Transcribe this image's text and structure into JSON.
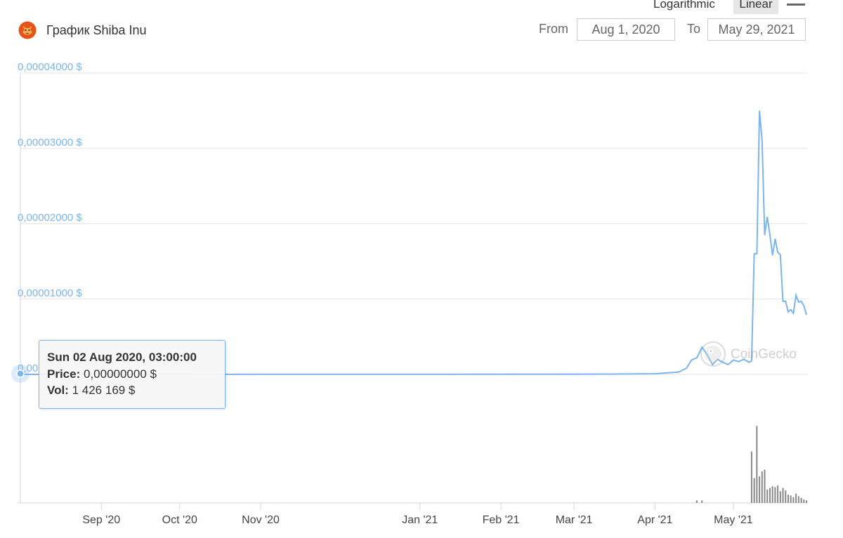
{
  "header": {
    "title": "График Shiba Inu",
    "scale_options": [
      "Logarithmic",
      "Linear"
    ],
    "selected_scale": "Linear",
    "from_label": "From",
    "from_value": "Aug 1, 2020",
    "to_label": "To",
    "to_value": "May 29, 2021"
  },
  "watermark": "CoinGecko",
  "tooltip": {
    "date": "Sun 02 Aug 2020, 03:00:00",
    "price_label": "Price:",
    "price_value": "0,00000000 $",
    "vol_label": "Vol:",
    "vol_value": "1 426 169 $"
  },
  "colors": {
    "price_line": "#7cb5ec",
    "volume_bars": "#888888",
    "tooltip_border": "#7cb5ec"
  },
  "chart_data": {
    "type": "line",
    "x_start": "2020-08-01",
    "x_end": "2021-05-29",
    "ylim": [
      0,
      4e-05
    ],
    "y_ticks": [
      "0,00004000 $",
      "0,00003000 $",
      "0,00002000 $",
      "0,00001000 $",
      "0,00"
    ],
    "x_ticks": [
      "Sep '20",
      "Oct '20",
      "Nov '20",
      "Jan '21",
      "Feb '21",
      "Mar '21",
      "Apr '21",
      "May '21"
    ],
    "x_tick_dates": [
      "2020-09-01",
      "2020-10-01",
      "2020-11-01",
      "2021-01-01",
      "2021-02-01",
      "2021-03-01",
      "2021-04-01",
      "2021-05-01"
    ],
    "price_series": {
      "dates": [
        "2020-08-01",
        "2020-12-01",
        "2021-02-20",
        "2021-03-15",
        "2021-04-01",
        "2021-04-10",
        "2021-04-13",
        "2021-04-15",
        "2021-04-17",
        "2021-04-19",
        "2021-04-21",
        "2021-04-23",
        "2021-04-25",
        "2021-04-27",
        "2021-04-29",
        "2021-05-01",
        "2021-05-03",
        "2021-05-05",
        "2021-05-07",
        "2021-05-08",
        "2021-05-09",
        "2021-05-10",
        "2021-05-11",
        "2021-05-12",
        "2021-05-13",
        "2021-05-14",
        "2021-05-15",
        "2021-05-16",
        "2021-05-17",
        "2021-05-18",
        "2021-05-19",
        "2021-05-20",
        "2021-05-21",
        "2021-05-22",
        "2021-05-23",
        "2021-05-24",
        "2021-05-25",
        "2021-05-26",
        "2021-05-27",
        "2021-05-28",
        "2021-05-29"
      ],
      "values": [
        0,
        1e-08,
        2e-08,
        4e-08,
        8e-08,
        3e-07,
        8e-07,
        1.9e-06,
        2.2e-06,
        3.6e-06,
        2.6e-06,
        1.3e-06,
        2e-06,
        1.6e-06,
        1.3e-06,
        1.9e-06,
        1.7e-06,
        2e-06,
        1.6e-06,
        1.8e-06,
        1.6e-05,
        1.6e-05,
        3.5e-05,
        3.1e-05,
        1.85e-05,
        2.09e-05,
        1.85e-05,
        1.58e-05,
        1.8e-05,
        1.62e-05,
        1.59e-05,
        9.7e-06,
        9.7e-06,
        8.3e-06,
        8.6e-06,
        8.1e-06,
        1.05e-05,
        9.6e-06,
        9.7e-06,
        9.1e-06,
        7.9e-06
      ]
    },
    "volume_series": {
      "dates": [
        "2021-04-17",
        "2021-04-19",
        "2021-05-08",
        "2021-05-09",
        "2021-05-10",
        "2021-05-11",
        "2021-05-12",
        "2021-05-13",
        "2021-05-14",
        "2021-05-15",
        "2021-05-16",
        "2021-05-17",
        "2021-05-18",
        "2021-05-19",
        "2021-05-20",
        "2021-05-21",
        "2021-05-22",
        "2021-05-23",
        "2021-05-24",
        "2021-05-25",
        "2021-05-26",
        "2021-05-27",
        "2021-05-28",
        "2021-05-29"
      ],
      "relative_values": [
        0.03,
        0.03,
        0.62,
        0.3,
        0.93,
        0.32,
        0.38,
        0.4,
        0.16,
        0.18,
        0.2,
        0.19,
        0.21,
        0.14,
        0.18,
        0.15,
        0.1,
        0.09,
        0.07,
        0.11,
        0.08,
        0.06,
        0.04,
        0.03
      ]
    }
  }
}
